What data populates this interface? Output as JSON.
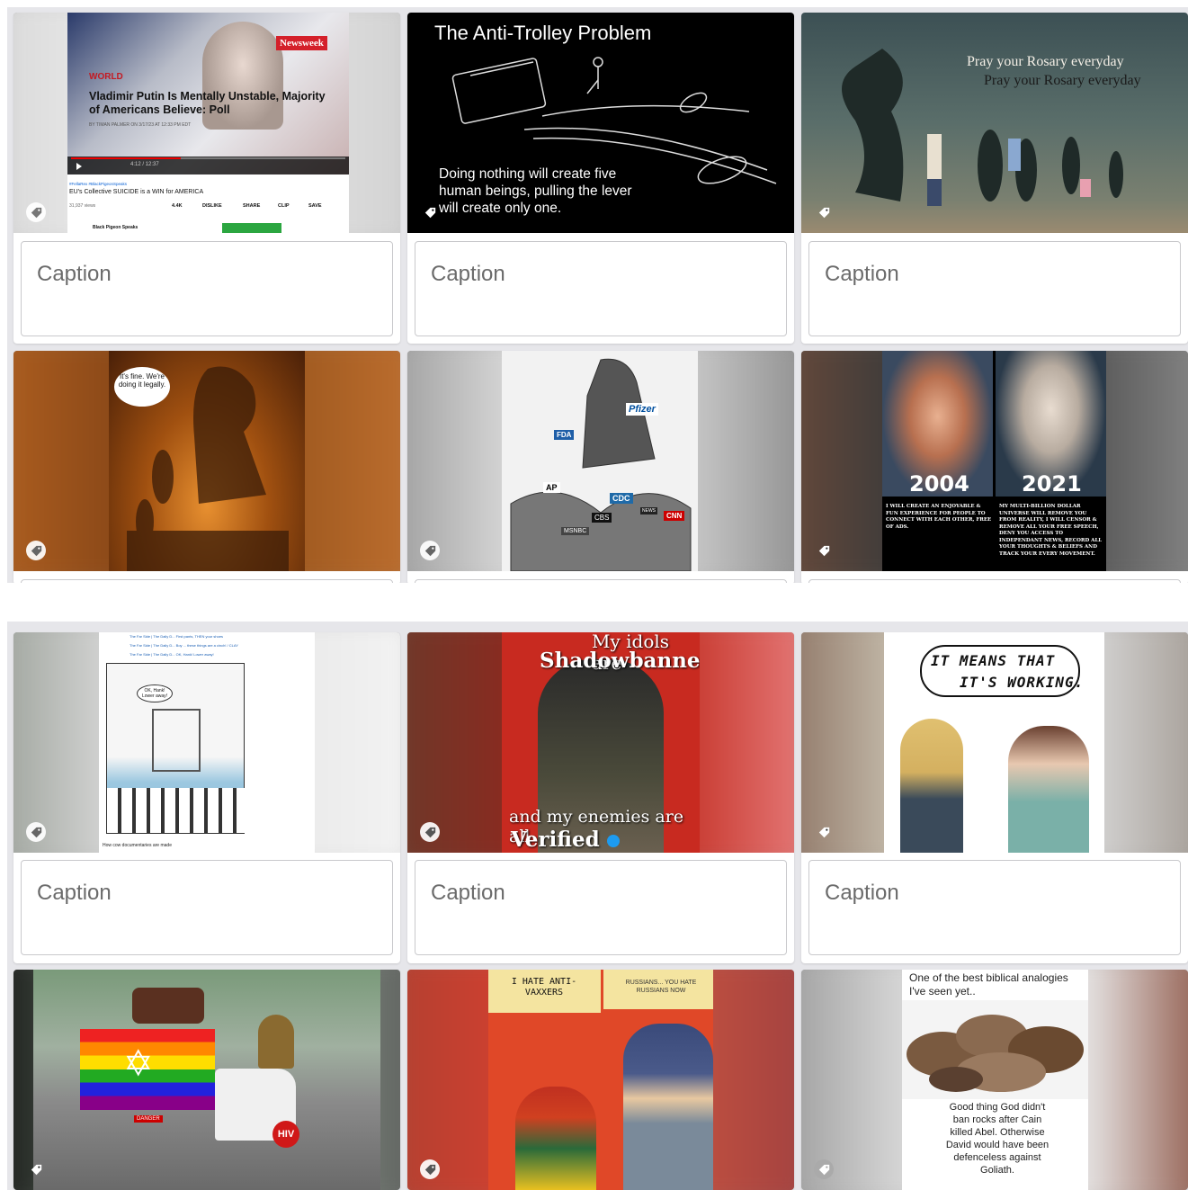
{
  "caption_placeholder": "Caption",
  "cards": [
    {
      "id": "putin",
      "headline": "Vladimir Putin Is Mentally Unstable, Majority of Americans Believe: Poll",
      "section": "WORLD",
      "brand": "Newsweek",
      "byline": "BY TIMAN PALMER ON 3/17/23 AT 12:33 PM EDT",
      "hashtags": "#FellaRex #BlackPigeonSpeaks",
      "video_title": "EU's Collective SUICIDE is a WIN for AMERICA",
      "views": "31,937 views",
      "likes": "4.4K",
      "dislike": "DISLIKE",
      "share": "SHARE",
      "clip": "CLIP",
      "save": "SAVE",
      "channel": "Black Pigeon Speaks",
      "time": "4:12 / 12:37"
    },
    {
      "id": "trolley",
      "title": "The Anti-Trolley Problem",
      "body": "Doing nothing will create five human beings, pulling the lever will create only one."
    },
    {
      "id": "rosary",
      "line1": "Pray your Rosary everyday",
      "line2": "Pray your Rosary everyday"
    },
    {
      "id": "moloch",
      "bubble": "It's fine. We're doing it legally."
    },
    {
      "id": "pfizer",
      "labels": [
        "Pfizer",
        "FDA",
        "AP",
        "CDC",
        "CBS",
        "MSNBC",
        "CNN",
        "NEWS"
      ]
    },
    {
      "id": "zuck",
      "year_left": "2004",
      "year_right": "2021",
      "text_left": "I WILL CREATE AN ENJOYABLE & FUN EXPERIENCE FOR PEOPLE TO CONNECT WITH EACH OTHER, FREE OF ADS.",
      "text_right": "MY MULTI-BILLION DOLLAR UNIVERSE WILL REMOVE YOU FROM REALITY, I WILL CENSOR & REMOVE ALL YOUR FREE SPEECH, DENY YOU ACCESS TO INDEPENDANT NEWS, RECORD ALL YOUR THOUGHTS & BELIEFS AND TRACK YOUR EVERY MOVEMENT."
    },
    {
      "id": "farside",
      "bubble": "OK, Hank! Lower away!",
      "bottom": "How cow documentaries are made",
      "rows": [
        "The Far Side | The Daily D... First pants, THEN your shoes",
        "The Far Side | The Daily D... Boy ... these things are a cinch! / CLAY",
        "The Far Side | The Daily D... OK, Hank! Lower away!"
      ]
    },
    {
      "id": "shadow",
      "top1": "My idols are",
      "top2": "Shadowbanned",
      "bottom1": "and my enemies are all",
      "bottom2": "Verified"
    },
    {
      "id": "working",
      "bubble1": "IT MEANS THAT",
      "bubble2": "IT'S WORKING."
    },
    {
      "id": "truck",
      "sign": "HIV",
      "hazard": "DANGER"
    },
    {
      "id": "batman",
      "left": "I HATE ANTI- VAXXERS",
      "right": "RUSSIANS... YOU HATE RUSSIANS NOW"
    },
    {
      "id": "rocks",
      "top": "One of the best biblical analogies I've seen yet..",
      "bottom": "Good thing God didn't ban rocks after Cain killed Abel. Otherwise David would have been defenceless against Goliath."
    }
  ],
  "colors": {
    "strip": "#e6e6ea",
    "caption_border": "#c9c9cc",
    "caption_text": "#6b6b6b"
  }
}
